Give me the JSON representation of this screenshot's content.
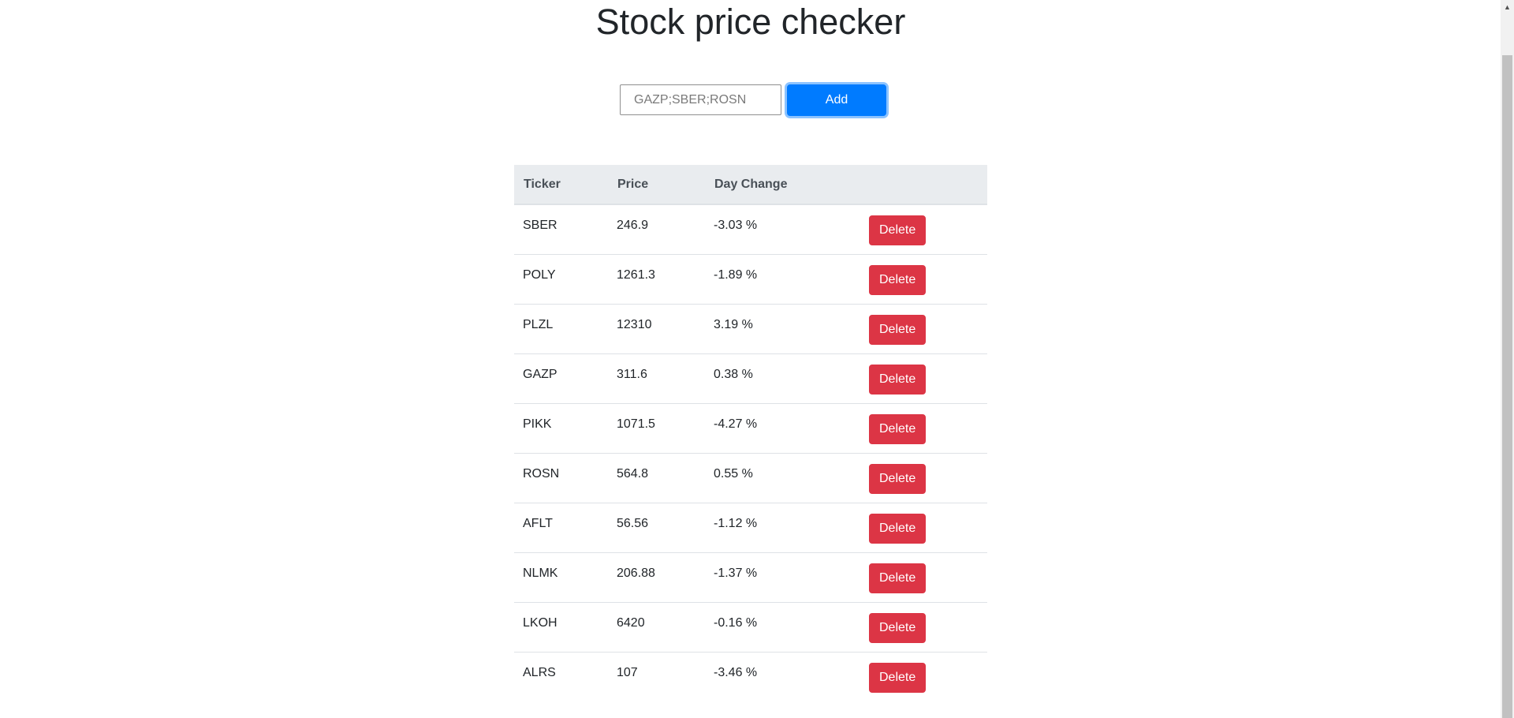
{
  "header": {
    "title": "Stock price checker"
  },
  "form": {
    "input_placeholder": "GAZP;SBER;ROSN",
    "add_label": "Add"
  },
  "table": {
    "columns": [
      "Ticker",
      "Price",
      "Day Change",
      ""
    ],
    "delete_label": "Delete",
    "rows": [
      {
        "ticker": "SBER",
        "price": "246.9",
        "change": "-3.03 %"
      },
      {
        "ticker": "POLY",
        "price": "1261.3",
        "change": "-1.89 %"
      },
      {
        "ticker": "PLZL",
        "price": "12310",
        "change": "3.19 %"
      },
      {
        "ticker": "GAZP",
        "price": "311.6",
        "change": "0.38 %"
      },
      {
        "ticker": "PIKK",
        "price": "1071.5",
        "change": "-4.27 %"
      },
      {
        "ticker": "ROSN",
        "price": "564.8",
        "change": "0.55 %"
      },
      {
        "ticker": "AFLT",
        "price": "56.56",
        "change": "-1.12 %"
      },
      {
        "ticker": "NLMK",
        "price": "206.88",
        "change": "-1.37 %"
      },
      {
        "ticker": "LKOH",
        "price": "6420",
        "change": "-0.16 %"
      },
      {
        "ticker": "ALRS",
        "price": "107",
        "change": "-3.46 %"
      }
    ]
  },
  "colors": {
    "primary": "#007bff",
    "danger": "#dc3545",
    "table_header_bg": "#e9ecef"
  },
  "icons": {
    "scroll_up": "chevron-up-icon"
  }
}
